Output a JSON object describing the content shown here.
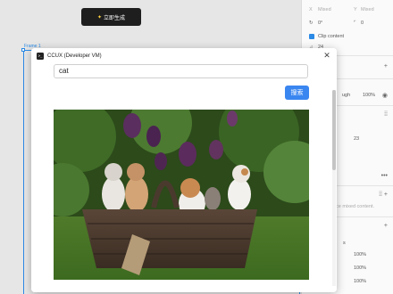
{
  "canvas": {
    "generate_button": "立即生成",
    "frame_label": "Frame 1"
  },
  "panel": {
    "mixed_1": "Mixed",
    "mixed_2": "Mixed",
    "rotation": "0°",
    "corner": "0",
    "clip_content": "Clip content",
    "size_value": "24",
    "pass_through": "ugh",
    "opacity": "100%",
    "font_size": "23",
    "letter_spacing": "0%",
    "mixed_note": "ce mixed content.",
    "fills": [
      "100%",
      "100%",
      "100%"
    ],
    "section_label": "s"
  },
  "window": {
    "title": "CCUX (Developer VM)",
    "app_icon_text": ">_",
    "search": {
      "value": "cat",
      "button_label": "搜索"
    },
    "image_alt": "Kittens in a wicker basket"
  },
  "colors": {
    "accent": "#3a86f0",
    "frame_blue": "#2b8ae6"
  }
}
